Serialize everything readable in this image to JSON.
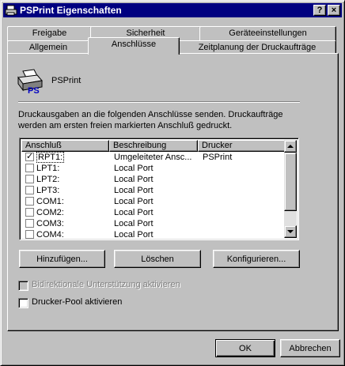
{
  "window": {
    "title": "PSPrint Eigenschaften"
  },
  "titlebar_buttons": {
    "help": "?",
    "close": "×"
  },
  "tabs": {
    "back": [
      "Freigabe",
      "Sicherheit",
      "Geräteeinstellungen"
    ],
    "front": [
      "Allgemein",
      "Anschlüsse",
      "Zeitplanung der Druckaufträge"
    ],
    "active": "Anschlüsse"
  },
  "printer": {
    "name": "PSPrint",
    "icon": "printer-ps-icon",
    "icon_text": "PS"
  },
  "description": "Druckausgaben an die folgenden Anschlüsse senden. Druckaufträge werden am ersten freien markierten Anschluß gedruckt.",
  "ports": {
    "columns": [
      "Anschluß",
      "Beschreibung",
      "Drucker"
    ],
    "rows": [
      {
        "checked": true,
        "port": "RPT1:",
        "desc": "Umgeleiteter Ansc...",
        "printer": "PSPrint",
        "selected": true
      },
      {
        "checked": false,
        "port": "LPT1:",
        "desc": "Local Port",
        "printer": ""
      },
      {
        "checked": false,
        "port": "LPT2:",
        "desc": "Local Port",
        "printer": ""
      },
      {
        "checked": false,
        "port": "LPT3:",
        "desc": "Local Port",
        "printer": ""
      },
      {
        "checked": false,
        "port": "COM1:",
        "desc": "Local Port",
        "printer": ""
      },
      {
        "checked": false,
        "port": "COM2:",
        "desc": "Local Port",
        "printer": ""
      },
      {
        "checked": false,
        "port": "COM3:",
        "desc": "Local Port",
        "printer": ""
      },
      {
        "checked": false,
        "port": "COM4:",
        "desc": "Local Port",
        "printer": ""
      }
    ]
  },
  "port_buttons": {
    "add": "Hinzufügen...",
    "delete": "Löschen",
    "configure": "Konfigurieren..."
  },
  "options": {
    "bidirectional": {
      "label": "Bidirektionale Unterstützung aktivieren",
      "checked": false,
      "enabled": false
    },
    "pool": {
      "label": "Drucker-Pool aktivieren",
      "checked": false,
      "enabled": true
    }
  },
  "dialog_buttons": {
    "ok": "OK",
    "cancel": "Abbrechen"
  },
  "colors": {
    "titlebar": "#000080",
    "face": "#c0c0c0",
    "ps_blue": "#0000c0"
  }
}
